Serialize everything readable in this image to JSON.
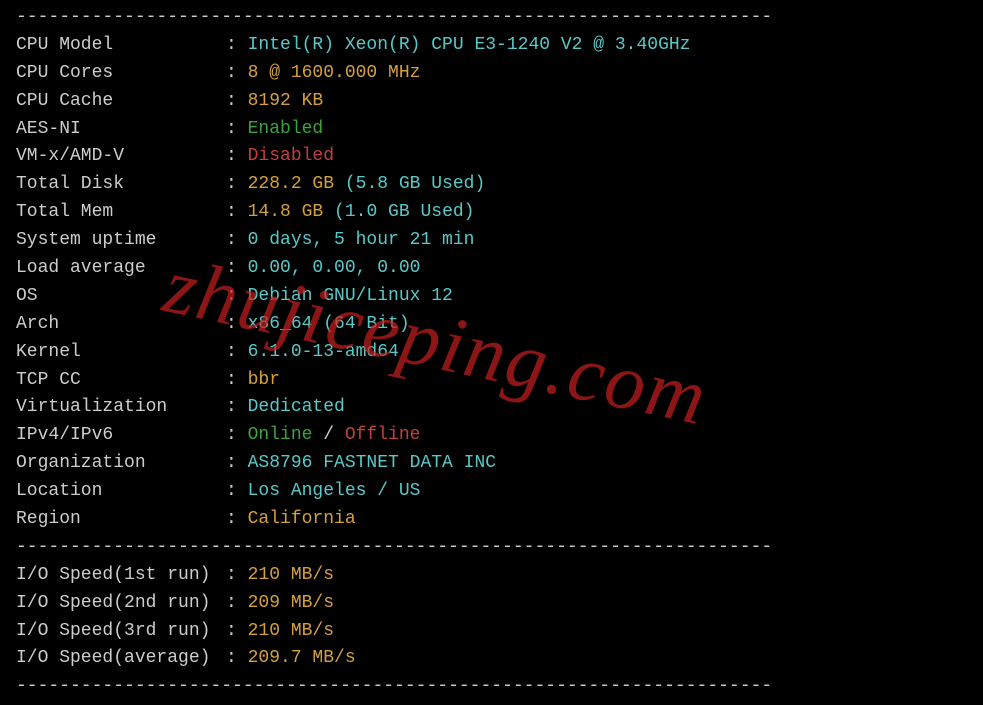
{
  "divider": "----------------------------------------------------------------------",
  "specs": {
    "cpu_model": {
      "label": "CPU Model",
      "value": "Intel(R) Xeon(R) CPU E3-1240 V2 @ 3.40GHz"
    },
    "cpu_cores": {
      "label": "CPU Cores",
      "value": "8 @ 1600.000 MHz"
    },
    "cpu_cache": {
      "label": "CPU Cache",
      "value": "8192 KB"
    },
    "aes_ni": {
      "label": "AES-NI",
      "value": "Enabled"
    },
    "vmx": {
      "label": "VM-x/AMD-V",
      "value": "Disabled"
    },
    "total_disk": {
      "label": "Total Disk",
      "value": "228.2 GB",
      "extra": "(5.8 GB Used)"
    },
    "total_mem": {
      "label": "Total Mem",
      "value": "14.8 GB",
      "extra": "(1.0 GB Used)"
    },
    "uptime": {
      "label": "System uptime",
      "value": "0 days, 5 hour 21 min"
    },
    "load": {
      "label": "Load average",
      "value": "0.00, 0.00, 0.00"
    },
    "os": {
      "label": "OS",
      "value": "Debian GNU/Linux 12"
    },
    "arch": {
      "label": "Arch",
      "value": "x86_64 (64 Bit)"
    },
    "kernel": {
      "label": "Kernel",
      "value": "6.1.0-13-amd64"
    },
    "tcp_cc": {
      "label": "TCP CC",
      "value": "bbr"
    },
    "virt": {
      "label": "Virtualization",
      "value": "Dedicated"
    },
    "ipv": {
      "label": "IPv4/IPv6",
      "online": "Online",
      "sep": " / ",
      "offline": "Offline"
    },
    "org": {
      "label": "Organization",
      "value": "AS8796 FASTNET DATA INC"
    },
    "location": {
      "label": "Location",
      "value": "Los Angeles / US"
    },
    "region": {
      "label": "Region",
      "value": "California"
    }
  },
  "io": {
    "run1": {
      "label": "I/O Speed(1st run)",
      "value": "210 MB/s"
    },
    "run2": {
      "label": "I/O Speed(2nd run)",
      "value": "209 MB/s"
    },
    "run3": {
      "label": "I/O Speed(3rd run)",
      "value": "210 MB/s"
    },
    "avg": {
      "label": "I/O Speed(average)",
      "value": "209.7 MB/s"
    }
  },
  "watermark": "zhujiceping.com"
}
